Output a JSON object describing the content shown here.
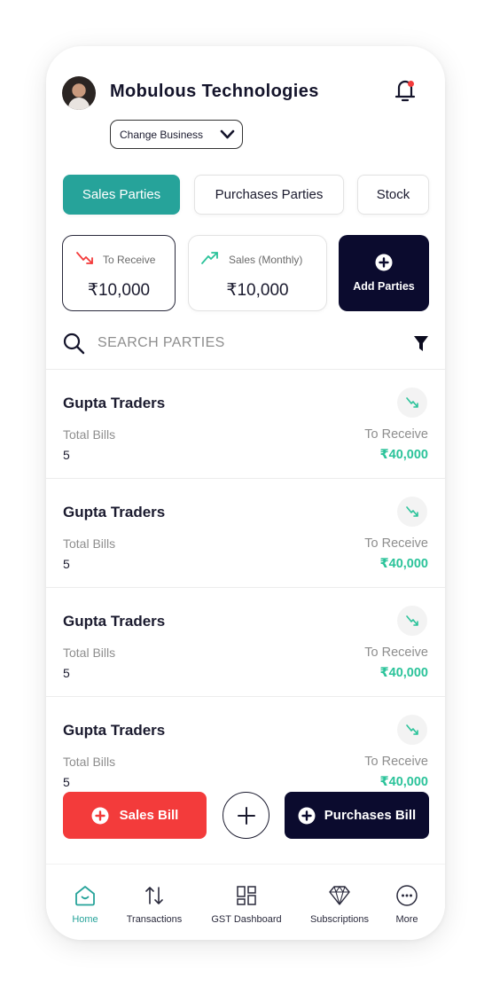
{
  "header": {
    "business_name": "Mobulous Technologies",
    "change_business_label": "Change Business"
  },
  "tabs": [
    {
      "label": "Sales Parties",
      "active": true
    },
    {
      "label": "Purchases Parties",
      "active": false
    },
    {
      "label": "Stock",
      "active": false
    }
  ],
  "summary": {
    "receive": {
      "label": "To Receive",
      "amount": "₹10,000"
    },
    "sales": {
      "label": "Sales (Monthly)",
      "amount": "₹10,000"
    },
    "add_parties_label": "Add Parties"
  },
  "search": {
    "placeholder": "SEARCH PARTIES"
  },
  "parties": [
    {
      "name": "Gupta Traders",
      "bills_label": "Total Bills",
      "bills": "5",
      "status_label": "To Receive",
      "amount": "₹40,000"
    },
    {
      "name": "Gupta Traders",
      "bills_label": "Total Bills",
      "bills": "5",
      "status_label": "To Receive",
      "amount": "₹40,000"
    },
    {
      "name": "Gupta Traders",
      "bills_label": "Total Bills",
      "bills": "5",
      "status_label": "To Receive",
      "amount": "₹40,000"
    },
    {
      "name": "Gupta Traders",
      "bills_label": "Total Bills",
      "bills": "5",
      "status_label": "To Receive",
      "amount": "₹40,000"
    }
  ],
  "actions": {
    "sales_bill_label": "Sales Bill",
    "purchases_bill_label": "Purchases Bill"
  },
  "bottom_nav": [
    {
      "label": "Home",
      "icon": "home-icon",
      "active": true
    },
    {
      "label": "Transactions",
      "icon": "transactions-icon",
      "active": false
    },
    {
      "label": "GST Dashboard",
      "icon": "dashboard-icon",
      "active": false
    },
    {
      "label": "Subscriptions",
      "icon": "diamond-icon",
      "active": false
    },
    {
      "label": "More",
      "icon": "more-icon",
      "active": false
    }
  ],
  "colors": {
    "accent_teal": "#26a39a",
    "navy": "#0b0b2e",
    "red": "#f33b3b",
    "green_amount": "#2bc39a"
  }
}
